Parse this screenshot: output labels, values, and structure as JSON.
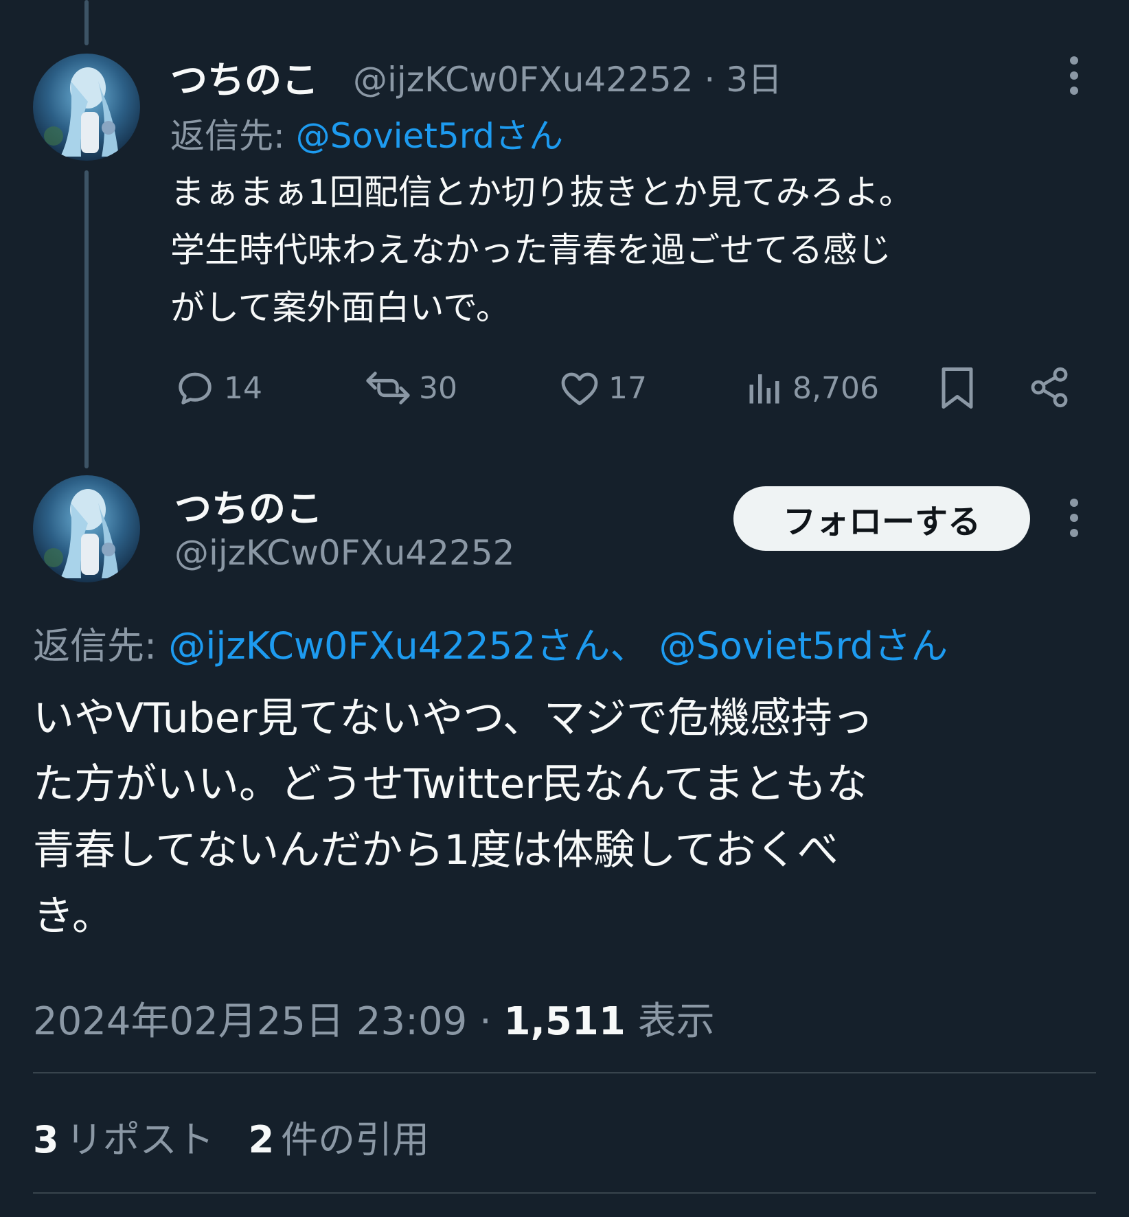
{
  "reply_tweet": {
    "display_name": "つちのこ",
    "handle": "@ijzKCw0FXu42252",
    "separator": "·",
    "time_ago": "3日",
    "reply_to_label": "返信先:",
    "reply_to_link": "@Soviet5rdさん",
    "text_lines": [
      "まぁまぁ1回配信とか切り抜きとか見てみろよ。",
      "学生時代味わえなかった青春を過ごせてる感じ",
      "がして案外面白いで。"
    ],
    "actions": {
      "replies": "14",
      "reposts": "30",
      "likes": "17",
      "views": "8,706"
    },
    "icons": [
      "reply-icon",
      "repost-icon",
      "like-icon",
      "views-icon",
      "bookmark-icon",
      "share-icon",
      "more-icon"
    ]
  },
  "main_tweet": {
    "display_name": "つちのこ",
    "handle": "@ijzKCw0FXu42252",
    "follow_label": "フォローする",
    "reply_to_label": "返信先:",
    "reply_to_link_1": "@ijzKCw0FXu42252さん、",
    "reply_to_link_2": "@Soviet5rdさん",
    "text_lines": [
      "いやVTuber見てないやつ、マジで危機感持っ",
      "た方がいい。どうせTwitter民なんてまともな",
      "青春してないんだから1度は体験しておくべ",
      "き。"
    ],
    "timestamp": "2024年02月25日 23:09",
    "separator": "·",
    "view_count": "1,511",
    "view_label": "表示",
    "stats": {
      "reposts_count": "3",
      "reposts_label": "リポスト",
      "quotes_count": "2",
      "quotes_label": "件の引用"
    }
  },
  "colors": {
    "background": "#15202b",
    "text": "#f7f9f9",
    "muted": "#8b98a5",
    "link": "#1d9bf0",
    "divider": "#38444d"
  }
}
